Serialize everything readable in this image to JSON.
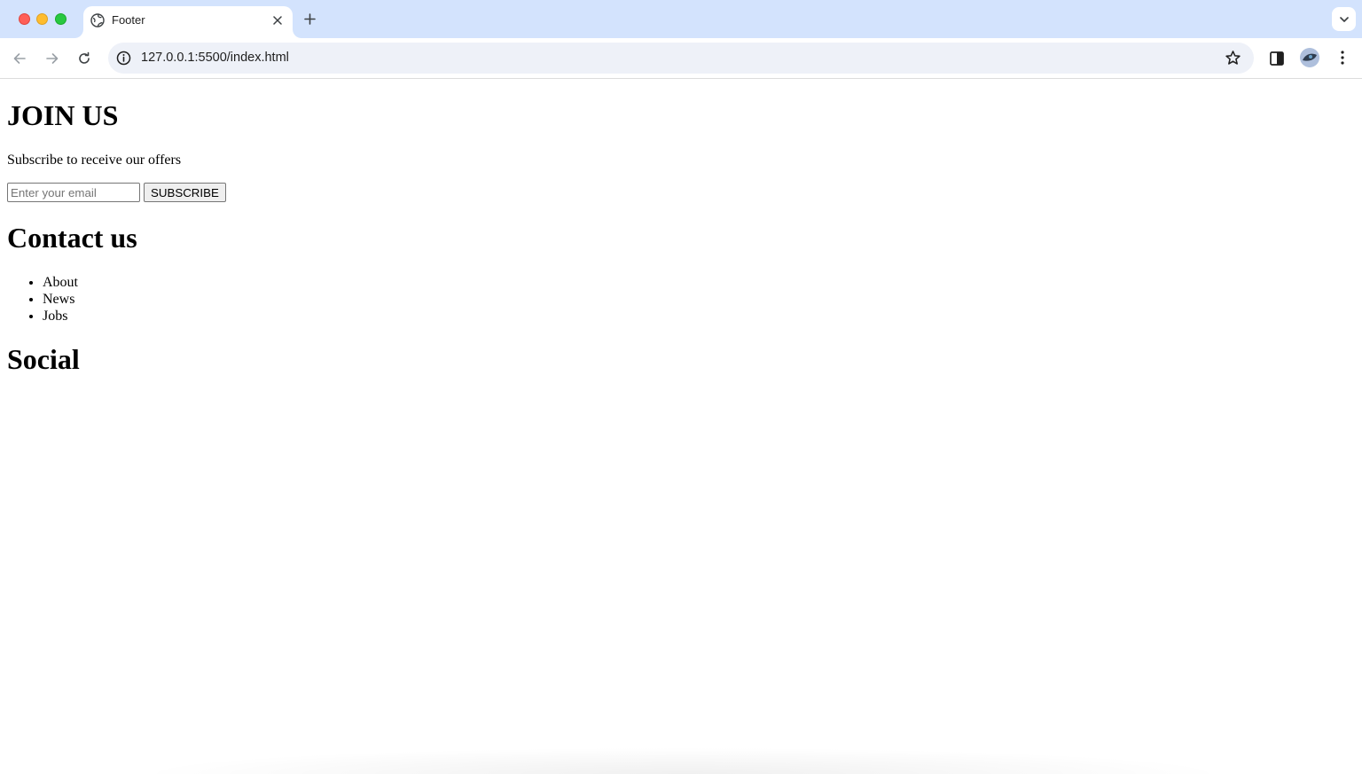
{
  "browser": {
    "tab": {
      "title": "Footer"
    },
    "omnibox": {
      "url": "127.0.0.1:5500/index.html"
    },
    "icons": {
      "favicon": "globe-icon",
      "tab_close": "close-icon",
      "new_tab": "plus-icon",
      "tab_search": "chevron-down-icon",
      "back": "arrow-left-icon",
      "forward": "arrow-right-icon",
      "reload": "reload-icon",
      "site_info": "info-icon",
      "bookmark": "star-icon",
      "side_panel": "side-panel-icon",
      "profile": "avatar",
      "menu": "kebab-menu-icon"
    }
  },
  "page": {
    "join": {
      "title": "JOIN US",
      "subtitle": "Subscribe to receive our offers",
      "email_placeholder": "Enter your email",
      "email_value": "",
      "subscribe_label": "SUBSCRIBE"
    },
    "contact": {
      "title": "Contact us",
      "links": [
        "About",
        "News",
        "Jobs"
      ]
    },
    "social": {
      "title": "Social"
    }
  }
}
